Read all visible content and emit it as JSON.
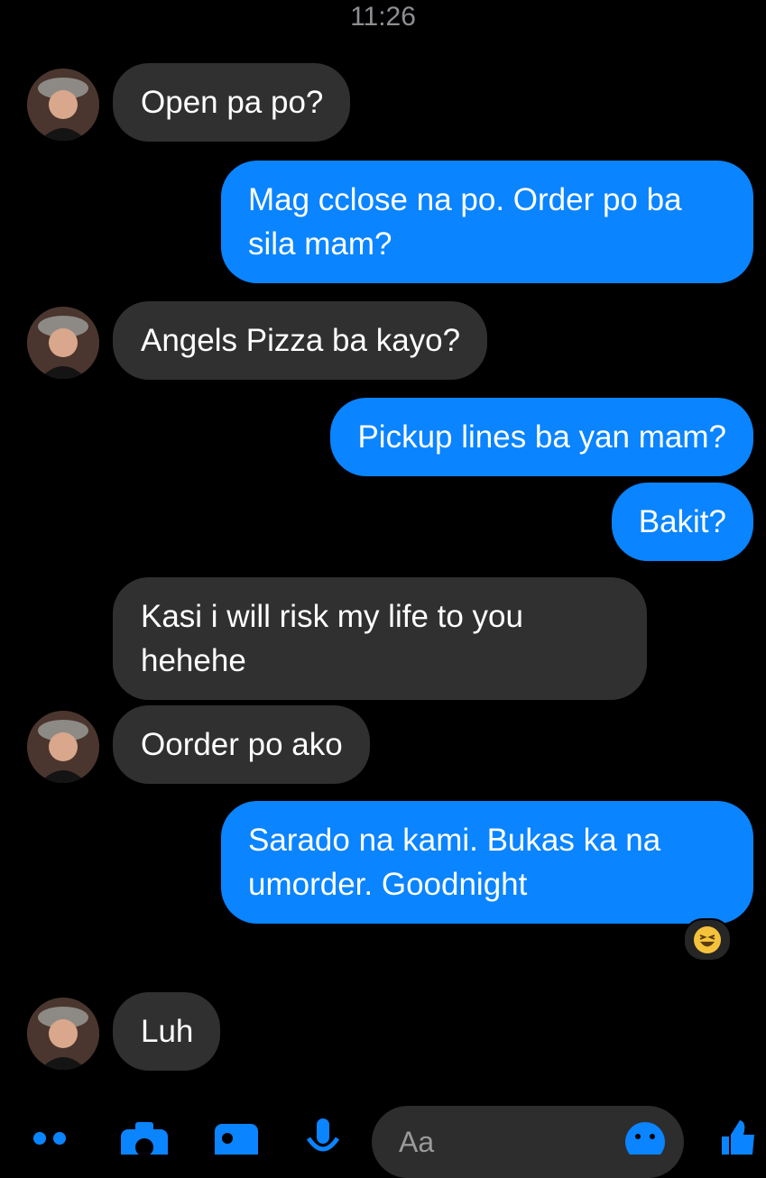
{
  "status": {
    "time": "11:26"
  },
  "messages": [
    {
      "from": "them",
      "text": "Open pa po?"
    },
    {
      "from": "me",
      "text": "Mag cclose na po. Order po ba sila mam?"
    },
    {
      "from": "them",
      "text": "Angels Pizza ba kayo?"
    },
    {
      "from": "me",
      "text": "Pickup lines ba yan mam?"
    },
    {
      "from": "me",
      "text": "Bakit?"
    },
    {
      "from": "them",
      "text": "Kasi i will risk my life to you hehehe"
    },
    {
      "from": "them",
      "text": "Oorder po ako"
    },
    {
      "from": "me",
      "text": "Sarado na kami. Bukas ka na umorder. Goodnight",
      "reaction": "laughing-emoji"
    },
    {
      "from": "them",
      "text": "Luh"
    }
  ],
  "composer": {
    "placeholder": "Aa",
    "icons": [
      "more-icon",
      "camera-icon",
      "gallery-icon",
      "microphone-icon",
      "emoji-icon",
      "thumbs-up-icon"
    ]
  },
  "colors": {
    "outgoing_bubble": "#0a84ff",
    "incoming_bubble": "#303030",
    "background": "#000000",
    "accent": "#0a84ff"
  }
}
